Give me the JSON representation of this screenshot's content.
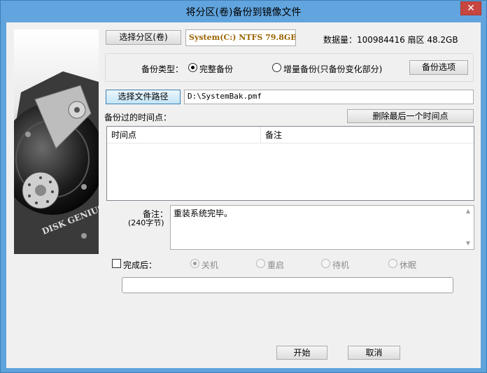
{
  "window": {
    "title": "将分区(卷)备份到镜像文件",
    "close_label": "✕"
  },
  "source": {
    "select_partition_label": "选择分区(卷)",
    "partition_info": "System(C:) NTFS 79.8GB",
    "data_amount": "数据量：100984416 扇区  48.2GB"
  },
  "backup_type": {
    "label": "备份类型：",
    "full_label": "完整备份",
    "incremental_label": "增量备份(只备份变化部分)",
    "selected": "full",
    "options_button": "备份选项"
  },
  "file": {
    "select_path_label": "选择文件路径",
    "path_value": "D:\\SystemBak.pmf"
  },
  "timepoints": {
    "label": "备份过的时间点：",
    "delete_last_button": "删除最后一个时间点",
    "columns": [
      "时间点",
      "备注"
    ],
    "rows": []
  },
  "note": {
    "label": "备注：",
    "sub_label": "(240字节)",
    "value": "重装系统完毕。"
  },
  "after_completion": {
    "checkbox_label": "完成后：",
    "checked": false,
    "options": [
      "关机",
      "重启",
      "待机",
      "休眠"
    ],
    "selected": "关机"
  },
  "progress": {
    "value": 0
  },
  "footer": {
    "start_button": "开始",
    "cancel_button": "取消"
  },
  "branding": {
    "logo_text": "DISK GENIUS"
  },
  "colors": {
    "title_bar": "#61a4de",
    "close_button": "#c7463f",
    "partition_text": "#9a6400"
  }
}
